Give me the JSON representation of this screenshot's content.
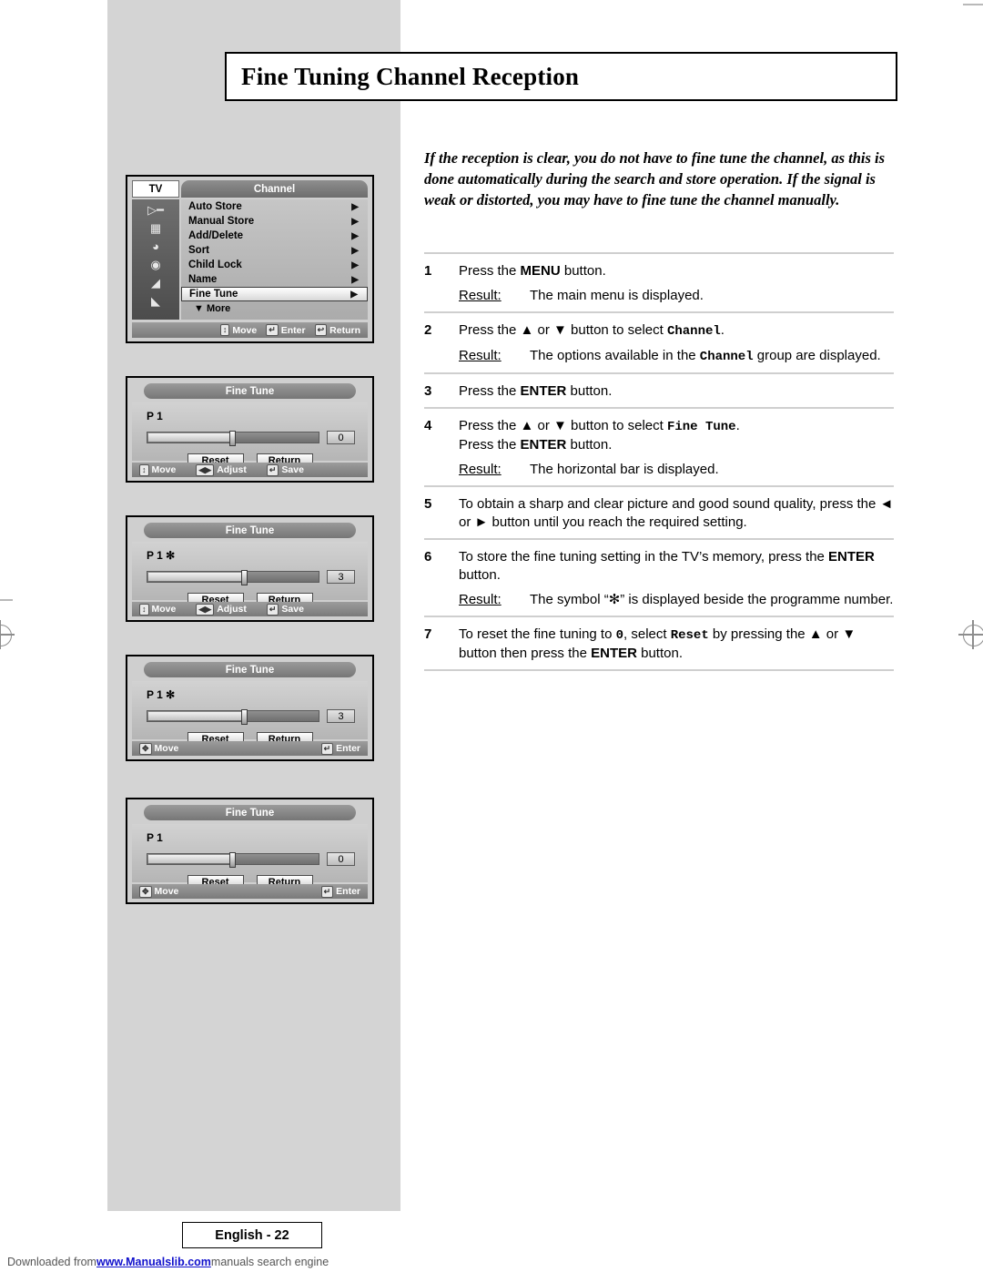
{
  "page": {
    "title": "Fine Tuning Channel Reception",
    "intro": "If the reception is clear, you do not have to fine tune the channel, as this is done automatically during the search and store operation. If the signal is weak or distorted, you may have to fine tune the channel manually.",
    "footer_label": "English - 22",
    "download_prefix": "Downloaded from ",
    "download_link": "www.Manualslib.com",
    "download_suffix": " manuals search engine"
  },
  "steps": [
    {
      "num": "1",
      "text_parts": [
        {
          "t": "Press the ",
          "s": "n"
        },
        {
          "t": "MENU",
          "s": "b"
        },
        {
          "t": " button.",
          "s": "n"
        }
      ],
      "result_label": "Result",
      "result": "The main menu is displayed."
    },
    {
      "num": "2",
      "text_parts": [
        {
          "t": "Press the ▲ or ▼ button to select ",
          "s": "n"
        },
        {
          "t": "Channel",
          "s": "m"
        },
        {
          "t": ".",
          "s": "n"
        }
      ],
      "result_label": "Result",
      "result_parts": [
        {
          "t": "The options available in the ",
          "s": "n"
        },
        {
          "t": "Channel",
          "s": "m"
        },
        {
          "t": " group are displayed.",
          "s": "n"
        }
      ]
    },
    {
      "num": "3",
      "text_parts": [
        {
          "t": "Press the ",
          "s": "n"
        },
        {
          "t": "ENTER",
          "s": "b"
        },
        {
          "t": " button.",
          "s": "n"
        }
      ]
    },
    {
      "num": "4",
      "text_parts": [
        {
          "t": "Press the ▲ or ▼ button to select ",
          "s": "n"
        },
        {
          "t": "Fine Tune",
          "s": "m"
        },
        {
          "t": ".",
          "s": "n"
        }
      ],
      "text_line2_parts": [
        {
          "t": "Press the ",
          "s": "n"
        },
        {
          "t": "ENTER",
          "s": "b"
        },
        {
          "t": " button.",
          "s": "n"
        }
      ],
      "result_label": "Result",
      "result": "The horizontal bar is displayed."
    },
    {
      "num": "5",
      "text_parts": [
        {
          "t": "To obtain a sharp and clear picture and good sound quality, press the ◄ or ► button until you reach the required setting.",
          "s": "n"
        }
      ]
    },
    {
      "num": "6",
      "text_parts": [
        {
          "t": "To store the fine tuning setting in the TV’s memory, press the ",
          "s": "n"
        },
        {
          "t": "ENTER",
          "s": "b"
        },
        {
          "t": " button.",
          "s": "n"
        }
      ],
      "result_label": "Result",
      "result": "The symbol “✻” is displayed beside the programme number."
    },
    {
      "num": "7",
      "text_parts": [
        {
          "t": "To reset the fine tuning to ",
          "s": "n"
        },
        {
          "t": "0",
          "s": "m"
        },
        {
          "t": ", select ",
          "s": "n"
        },
        {
          "t": "Reset",
          "s": "m"
        },
        {
          "t": " by pressing the ▲ or ▼ button then press the ",
          "s": "n"
        },
        {
          "t": "ENTER",
          "s": "b"
        },
        {
          "t": " button.",
          "s": "n"
        }
      ]
    }
  ],
  "menu_panel": {
    "tv_label": "TV",
    "group_label": "Channel",
    "items": [
      {
        "label": "Auto Store",
        "selected": false
      },
      {
        "label": "Manual Store",
        "selected": false
      },
      {
        "label": "Add/Delete",
        "selected": false
      },
      {
        "label": "Sort",
        "selected": false
      },
      {
        "label": "Child Lock",
        "selected": false
      },
      {
        "label": "Name",
        "selected": false
      },
      {
        "label": "Fine Tune",
        "selected": true
      },
      {
        "label": "More",
        "selected": false
      }
    ],
    "footer": [
      {
        "icon": "updown-arrows-icon",
        "label": "Move"
      },
      {
        "icon": "enter-key-icon",
        "label": "Enter"
      },
      {
        "icon": "return-key-icon",
        "label": "Return"
      }
    ]
  },
  "fine_tune_panels": [
    {
      "title": "Fine Tune",
      "programme": "P 1",
      "star": "",
      "value": "0",
      "bar_fill_pct": 50,
      "knob_pct": 50,
      "buttons": [
        "Reset",
        "Return"
      ],
      "footer": [
        {
          "icon": "updown-arrows-icon",
          "label": "Move"
        },
        {
          "icon": "leftright-arrows-icon",
          "label": "Adjust"
        },
        {
          "icon": "enter-key-icon",
          "label": "Save"
        }
      ]
    },
    {
      "title": "Fine Tune",
      "programme": "P 1",
      "star": "✻",
      "value": "3",
      "bar_fill_pct": 57,
      "knob_pct": 57,
      "buttons": [
        "Reset",
        "Return"
      ],
      "footer": [
        {
          "icon": "updown-arrows-icon",
          "label": "Move"
        },
        {
          "icon": "leftright-arrows-icon",
          "label": "Adjust"
        },
        {
          "icon": "enter-key-icon",
          "label": "Save"
        }
      ]
    },
    {
      "title": "Fine Tune",
      "programme": "P 1",
      "star": "✻",
      "value": "3",
      "bar_fill_pct": 57,
      "knob_pct": 57,
      "buttons": [
        "Reset",
        "Return"
      ],
      "footer": [
        {
          "icon": "four-way-arrows-icon",
          "label": "Move"
        },
        {
          "icon": "enter-key-icon",
          "label": "Enter"
        }
      ]
    },
    {
      "title": "Fine Tune",
      "programme": "P 1",
      "star": "",
      "value": "0",
      "bar_fill_pct": 50,
      "knob_pct": 50,
      "buttons": [
        "Reset",
        "Return"
      ],
      "footer": [
        {
          "icon": "four-way-arrows-icon",
          "label": "Move"
        },
        {
          "icon": "enter-key-icon",
          "label": "Enter"
        }
      ]
    }
  ]
}
